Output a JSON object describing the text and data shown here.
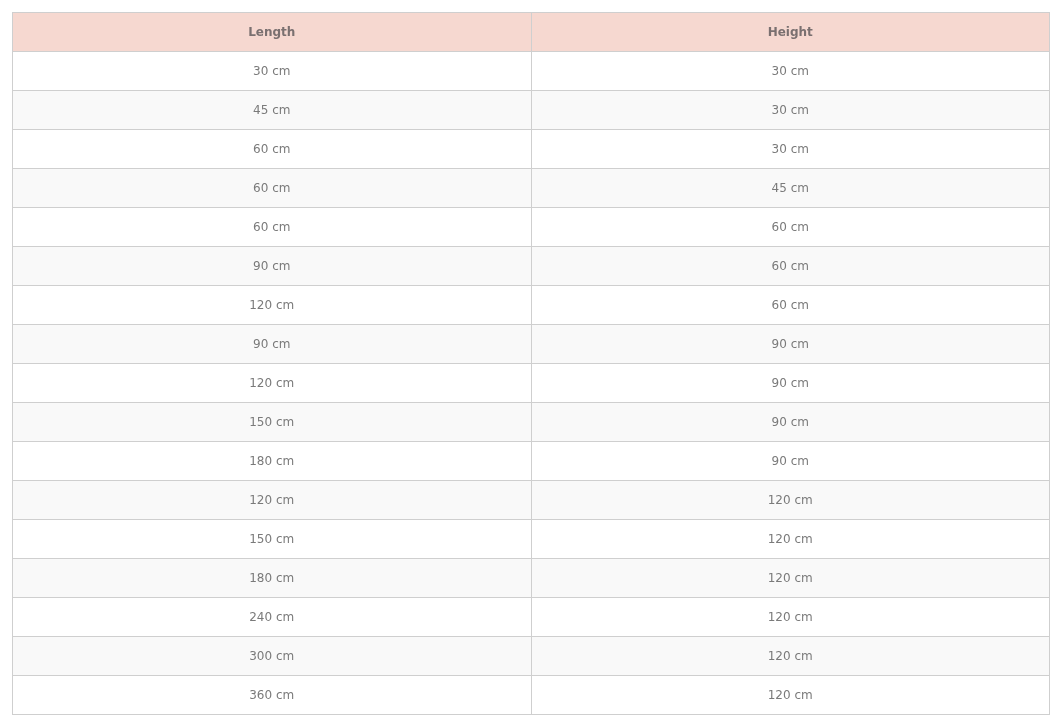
{
  "table": {
    "columns": [
      "Length",
      "Height"
    ],
    "rows": [
      [
        "30 cm",
        "30 cm"
      ],
      [
        "45 cm",
        "30 cm"
      ],
      [
        "60 cm",
        "30 cm"
      ],
      [
        "60 cm",
        "45 cm"
      ],
      [
        "60 cm",
        "60 cm"
      ],
      [
        "90 cm",
        "60 cm"
      ],
      [
        "120 cm",
        "60 cm"
      ],
      [
        "90 cm",
        "90 cm"
      ],
      [
        "120 cm",
        "90 cm"
      ],
      [
        "150 cm",
        "90 cm"
      ],
      [
        "180 cm",
        "90 cm"
      ],
      [
        "120 cm",
        "120 cm"
      ],
      [
        "150 cm",
        "120 cm"
      ],
      [
        "180 cm",
        "120 cm"
      ],
      [
        "240 cm",
        "120 cm"
      ],
      [
        "300 cm",
        "120 cm"
      ],
      [
        "360 cm",
        "120 cm"
      ]
    ]
  }
}
